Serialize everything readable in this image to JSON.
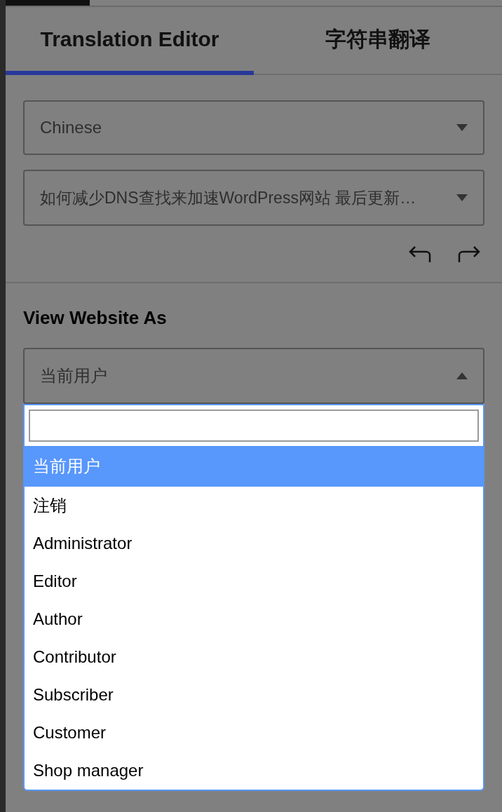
{
  "tabs": [
    {
      "label": "Translation Editor",
      "selected": true
    },
    {
      "label": "字符串翻译",
      "selected": false
    }
  ],
  "language_select": {
    "value": "Chinese"
  },
  "page_select": {
    "value": "如何减少DNS查找来加速WordPress网站 最后更新…"
  },
  "view_as": {
    "heading": "View Website As",
    "value": "当前用户",
    "expanded": true,
    "options": [
      {
        "label": "当前用户",
        "selected": true
      },
      {
        "label": "注销",
        "selected": false
      },
      {
        "label": "Administrator",
        "selected": false
      },
      {
        "label": "Editor",
        "selected": false
      },
      {
        "label": "Author",
        "selected": false
      },
      {
        "label": "Contributor",
        "selected": false
      },
      {
        "label": "Subscriber",
        "selected": false
      },
      {
        "label": "Customer",
        "selected": false
      },
      {
        "label": "Shop manager",
        "selected": false
      }
    ]
  }
}
